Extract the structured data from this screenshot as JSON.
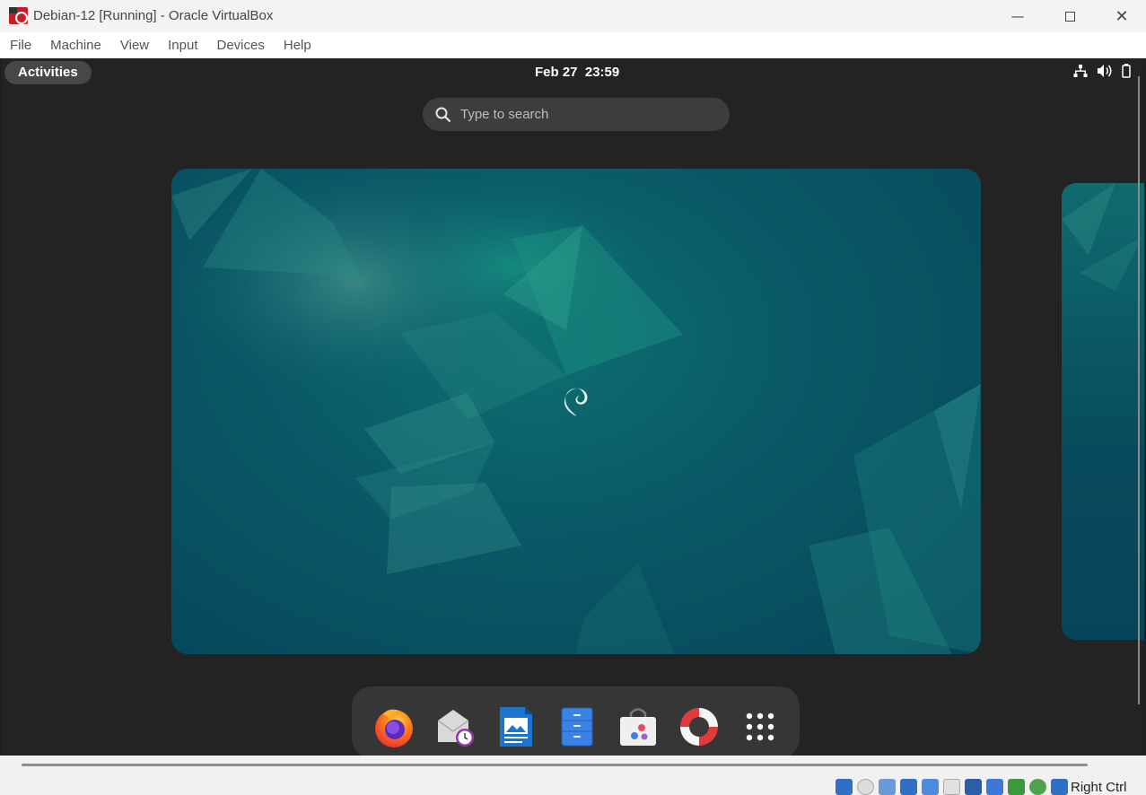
{
  "window": {
    "title": "Debian-12 [Running] - Oracle VirtualBox",
    "minimize": "—",
    "close": "✕"
  },
  "menubar": [
    "File",
    "Machine",
    "View",
    "Input",
    "Devices",
    "Help"
  ],
  "gnome": {
    "activities_label": "Activities",
    "clock": "Feb 27  23:59",
    "search_placeholder": "Type to search",
    "tray_icons": [
      "network-icon",
      "volume-icon",
      "battery-icon"
    ],
    "dock_apps": [
      "firefox",
      "evolution-mail",
      "libreoffice-writer",
      "files",
      "software",
      "help",
      "show-apps"
    ]
  },
  "statusbar": {
    "host_key": "Right Ctrl",
    "icons": [
      "hard-disk-icon",
      "optical-drive-icon",
      "audio-icon",
      "network-icon",
      "usb-icon",
      "shared-folders-icon",
      "display-icon",
      "video-capture-icon",
      "recording-icon",
      "cpu-icon",
      "mouse-integration-icon",
      "keyboard-icon"
    ]
  },
  "colors": {
    "guest_background": "#232323",
    "wallpaper_teal": "#0a5a68",
    "dock": "#363636",
    "vbox_red": "#c41e2b"
  }
}
